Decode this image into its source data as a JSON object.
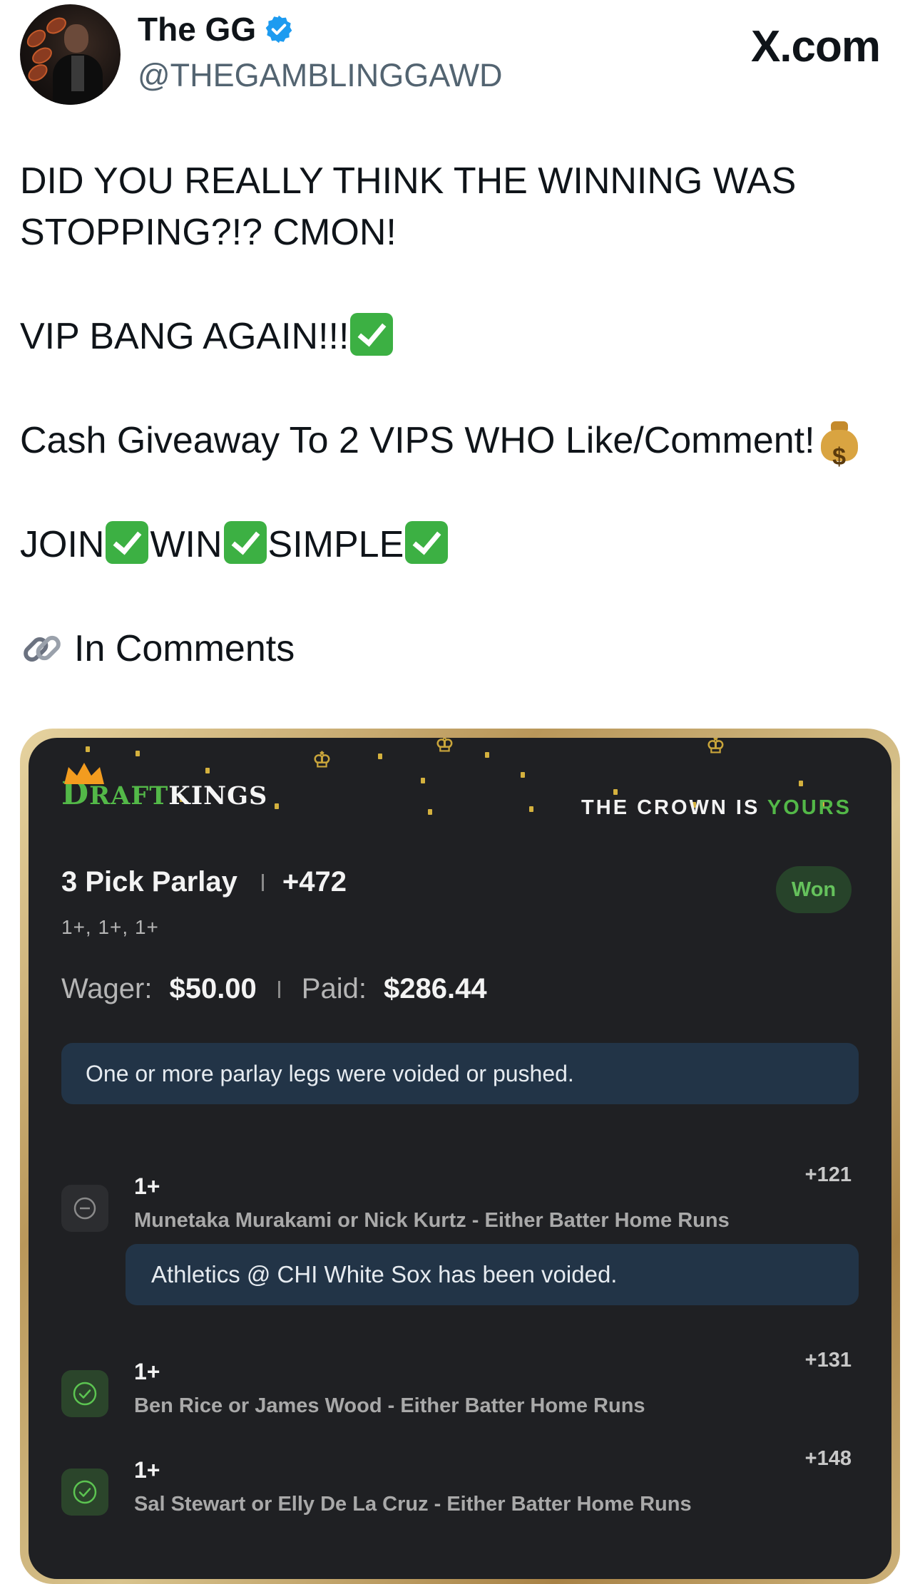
{
  "header": {
    "display_name": "The GG",
    "handle": "@THEGAMBLINGGAWD",
    "site": "X.com",
    "verified_icon": "verified-badge-icon",
    "accent_color": "#1d9bf0"
  },
  "tweet": {
    "line1": "DID YOU REALLY THINK THE WINNING WAS",
    "line2": "STOPPING?!? CMON!",
    "line3": "VIP BANG AGAIN!!!",
    "line4": "Cash Giveaway To 2 VIPS WHO Like/Comment!",
    "line5_parts": [
      "JOIN",
      "WIN",
      "SIMPLE"
    ],
    "line6": "In Comments",
    "icons": [
      "check-mark-emoji",
      "money-bag-emoji",
      "link-emoji"
    ]
  },
  "bet_slip": {
    "brand_draft": "RAFT",
    "brand_d": "D",
    "brand_kings": "KINGS",
    "slogan_prefix": "THE CROWN IS",
    "slogan_highlight": "YOURS",
    "title": "3 Pick Parlay",
    "odds": "+472",
    "status": "Won",
    "subtitle": "1+, 1+, 1+",
    "wager_label": "Wager:",
    "wager_value": "$50.00",
    "paid_label": "Paid:",
    "paid_value": "$286.44",
    "notice": "One or more parlay legs were voided or pushed.",
    "legs": [
      {
        "title": "1+",
        "desc": "Munetaka Murakami or Nick Kurtz - Either Batter Home Runs",
        "odds": "+121",
        "state": "void"
      },
      {
        "title": "1+",
        "desc": "Ben Rice or James Wood - Either Batter Home Runs",
        "odds": "+131",
        "state": "won"
      },
      {
        "title": "1+",
        "desc": "Sal Stewart or Elly De La Cruz - Either Batter Home Runs",
        "odds": "+148",
        "state": "won"
      }
    ],
    "void_notice": "Athletics @ CHI White Sox has been voided.",
    "colors": {
      "green": "#53b848",
      "card": "#1f2023",
      "notice": "#223447"
    }
  }
}
